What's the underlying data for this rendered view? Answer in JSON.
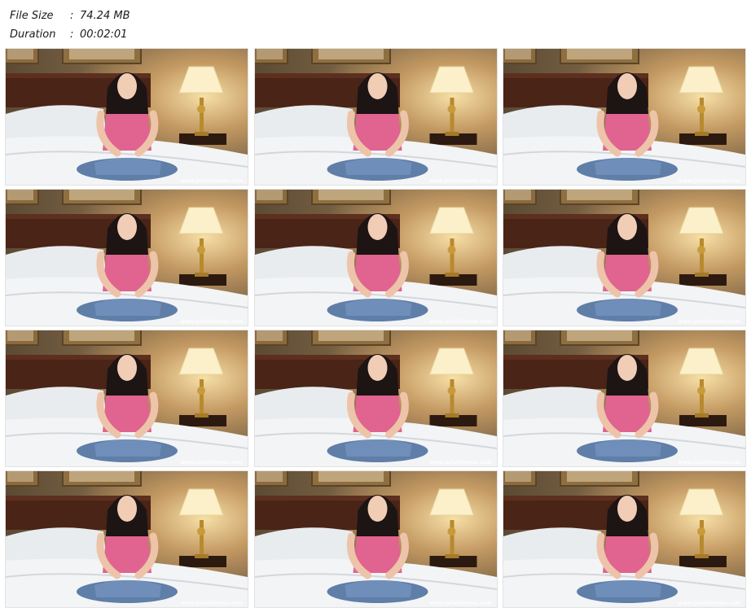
{
  "file_info": {
    "size_label": "File Size",
    "size_value": "74.24 MB",
    "duration_label": "Duration",
    "duration_value": "00:02:01",
    "separator": ":"
  },
  "thumbnails": {
    "count": 12,
    "watermark": "www.JulieSimone.com"
  }
}
